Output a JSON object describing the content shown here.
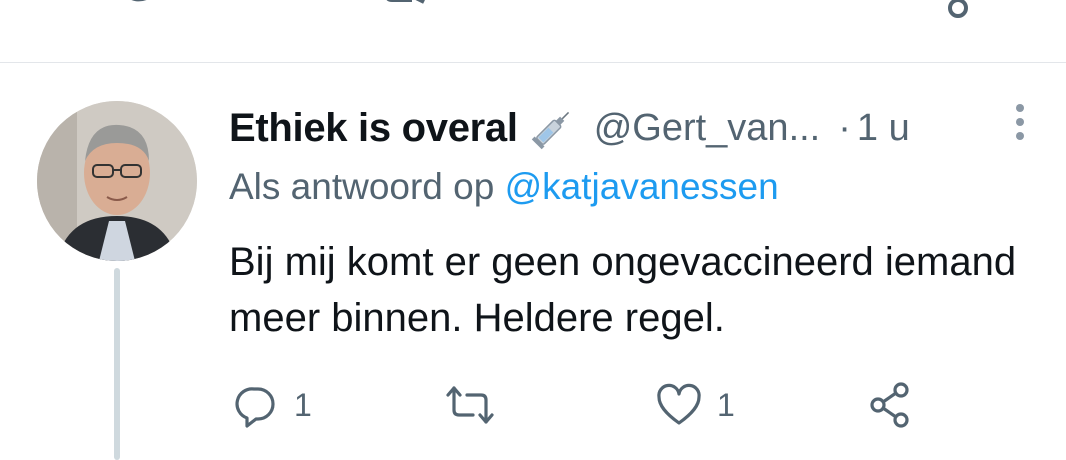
{
  "tweet": {
    "display_name": "Ethiek is overal",
    "name_emoji": "syringe-icon",
    "handle": "@Gert_van...",
    "separator": "·",
    "timestamp": "1 u",
    "reply_prefix": "Als antwoord op ",
    "reply_to": "@katjavanessen",
    "text": "Bij mij komt er geen ongevaccineerd iemand meer binnen. Heldere regel.",
    "counts": {
      "replies": "1",
      "retweets": "",
      "likes": "1"
    }
  },
  "colors": {
    "text_primary": "#0f1419",
    "text_secondary": "#536471",
    "link": "#1d9bf0",
    "divider": "#e3e6ea",
    "thread_line": "#cfd9de"
  }
}
